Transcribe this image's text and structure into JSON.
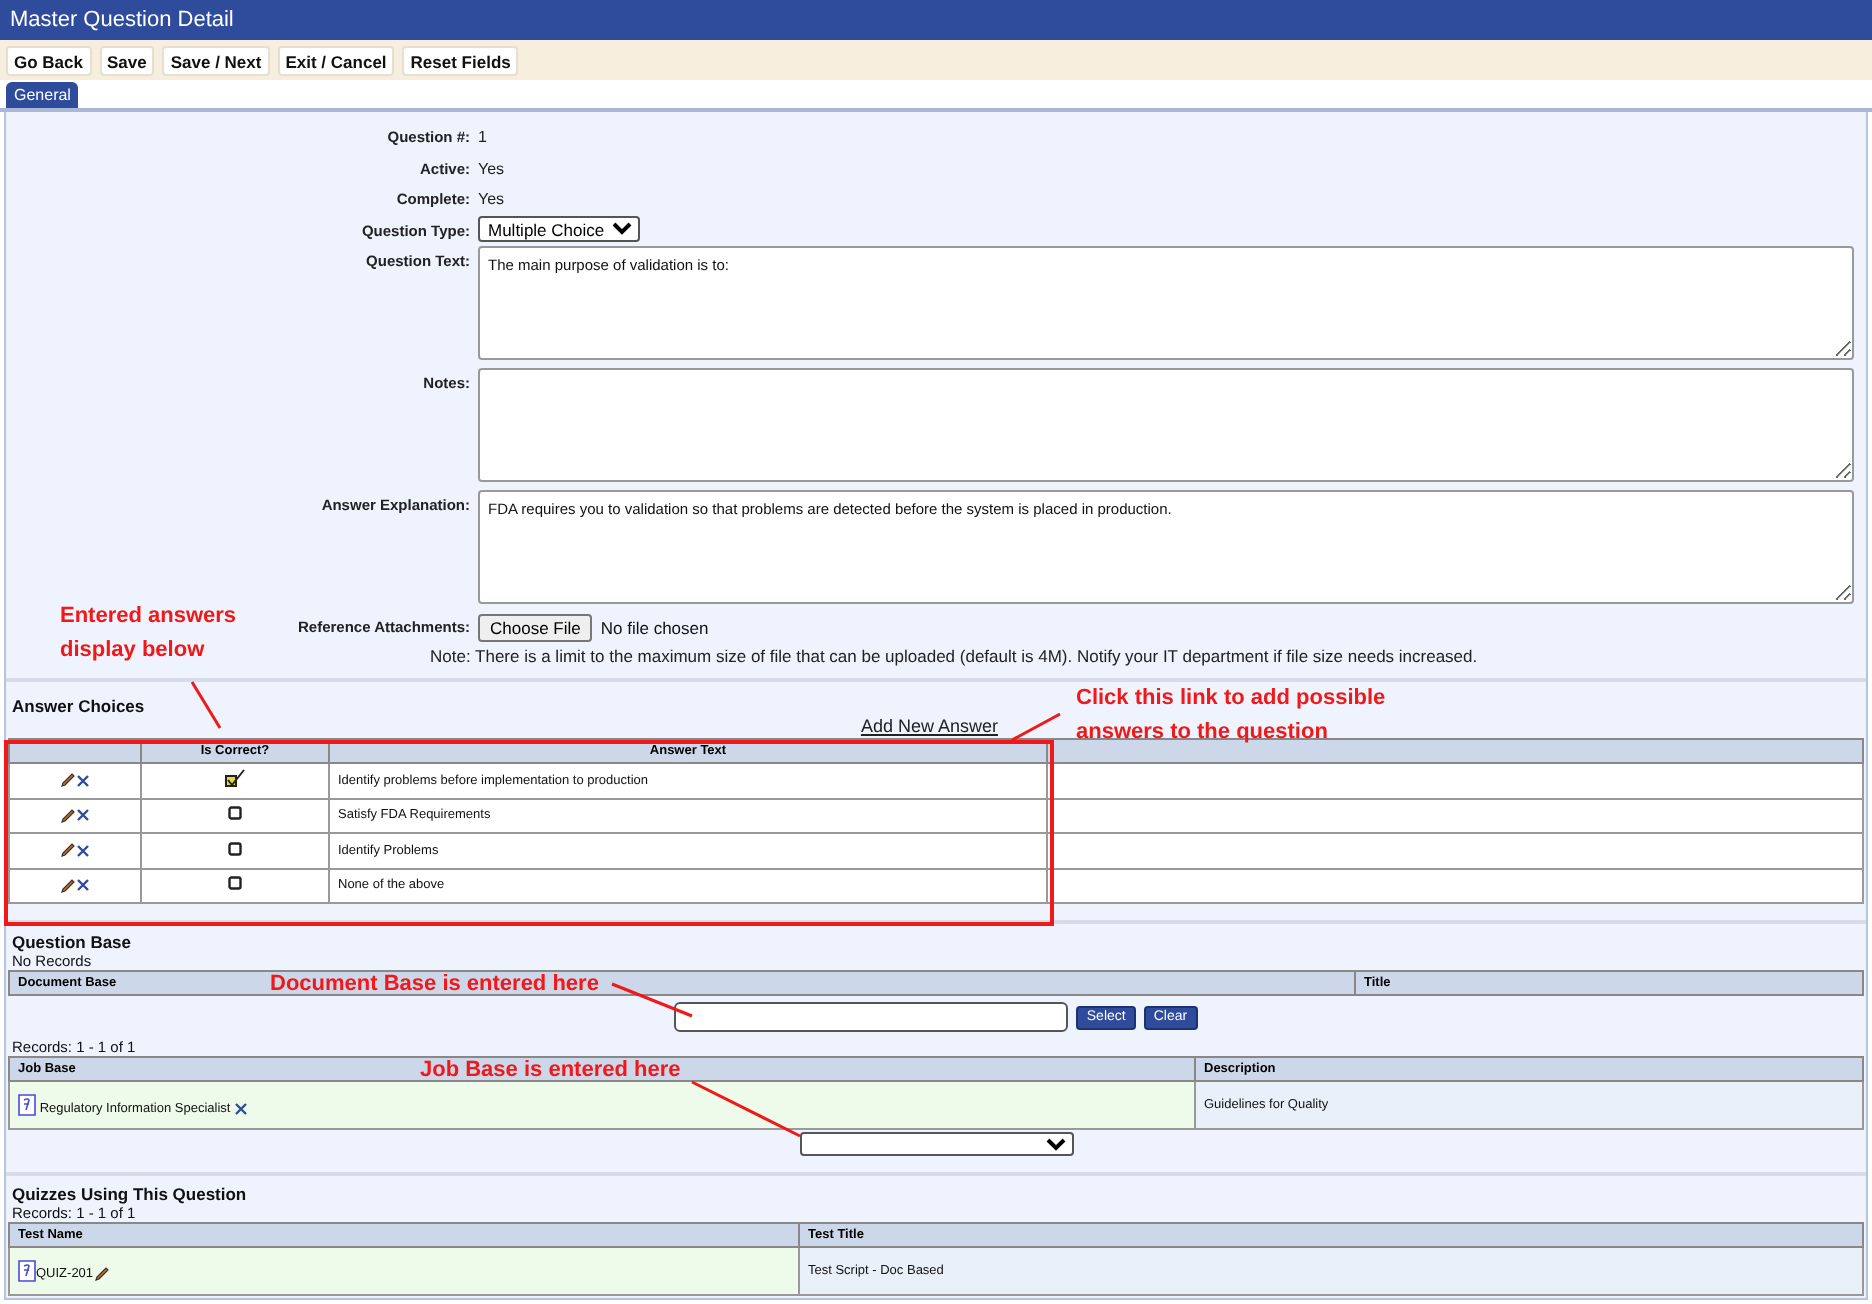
{
  "window": {
    "title": "Master Question Detail"
  },
  "toolbar": {
    "buttons": [
      "Go Back",
      "Save",
      "Save / Next",
      "Exit / Cancel",
      "Reset Fields"
    ]
  },
  "tabs": [
    {
      "label": "General",
      "selected": true
    }
  ],
  "fields": [
    {
      "kind": "text",
      "label": "Question #:",
      "value": "1"
    },
    {
      "kind": "text",
      "label": "Active:",
      "value": "Yes"
    },
    {
      "kind": "text",
      "label": "Complete:",
      "value": "Yes"
    },
    {
      "kind": "select",
      "label": "Question Type:",
      "value": "Multiple Choice"
    },
    {
      "kind": "textarea",
      "label": "Question Text:",
      "value": "The main purpose of validation is to:"
    },
    {
      "kind": "textarea",
      "label": "Notes:"
    },
    {
      "kind": "textarea",
      "label": "Answer Explanation:",
      "value": "FDA requires you to validation so that problems are detected before the system is placed in production."
    },
    {
      "kind": "file",
      "label": "Reference Attachments:",
      "button": "Choose File",
      "value": "No file chosen"
    }
  ],
  "note": "Note: There is a limit to the maximum size of file that can be uploaded (default is 4M). Notify your IT department if file size needs increased.",
  "answer_choices": {
    "title": "Answer Choices",
    "add_link": "Add New Answer",
    "columns": [
      "Is Correct?",
      "Answer Text"
    ],
    "rows": [
      {
        "correct": true,
        "text": "Identify problems before implementation to production"
      },
      {
        "correct": false,
        "text": "Satisfy FDA Requirements"
      },
      {
        "correct": false,
        "text": "Identify Problems"
      },
      {
        "correct": false,
        "text": "None of the above"
      }
    ]
  },
  "question_base": {
    "title": "Question Base",
    "status": "No Records",
    "columns": [
      "Document Base",
      "Title"
    ],
    "buttons": [
      "Select",
      "Clear"
    ]
  },
  "job_base": {
    "records": "Records: 1 - 1 of 1",
    "columns": [
      "Job Base",
      "Description"
    ],
    "rows": [
      {
        "name": "Regulatory Information Specialist",
        "description": "Guidelines for Quality"
      }
    ]
  },
  "quizzes": {
    "title": "Quizzes Using This Question",
    "records": "Records: 1 - 1 of 1",
    "columns": [
      "Test Name",
      "Test Title"
    ],
    "rows": [
      {
        "name": "QUIZ-201",
        "title": "Test Script - Doc Based"
      }
    ]
  },
  "annotations": [
    {
      "text": "Entered answers display below"
    },
    {
      "text": "Click this link to add possible answers to the question"
    },
    {
      "text": "Document Base is entered here"
    },
    {
      "text": "Job Base is entered here"
    }
  ]
}
